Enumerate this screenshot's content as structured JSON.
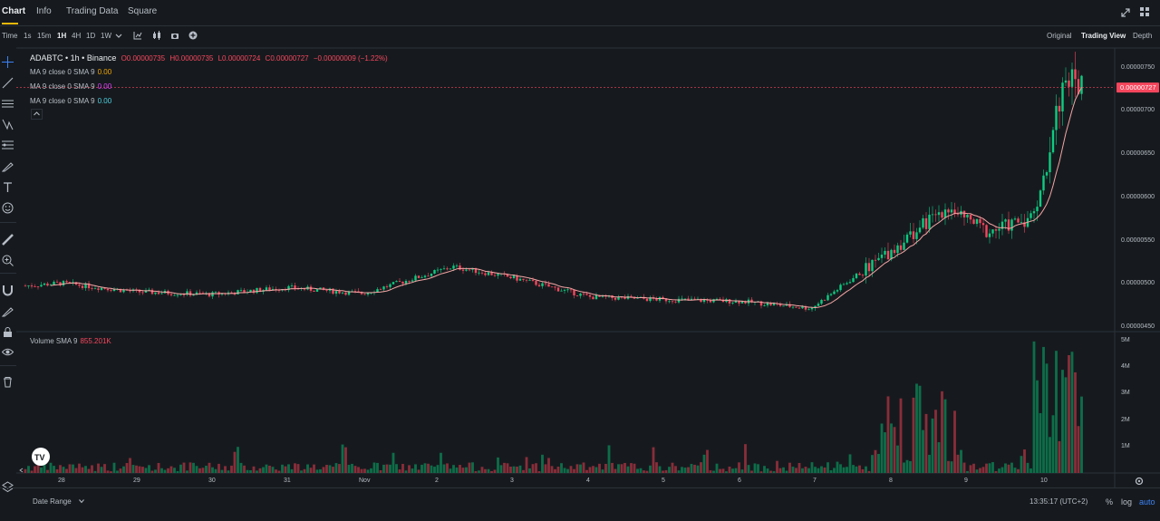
{
  "nav": {
    "tabs": [
      "Chart",
      "Info",
      "Trading Data",
      "Square"
    ]
  },
  "toolbar": {
    "time_label": "Time",
    "intervals": [
      "1s",
      "15m",
      "1H",
      "4H",
      "1D",
      "1W"
    ],
    "active_interval": "1H",
    "views": [
      "Original",
      "Trading View",
      "Depth"
    ],
    "active_view": "Trading View"
  },
  "legend": {
    "title": "ADABTC • 1h • Binance",
    "open": "O0.00000735",
    "high": "H0.00000735",
    "low": "L0.00000724",
    "close": "C0.00000727",
    "change": "−0.00000009 (−1.22%)",
    "ma_lines": [
      {
        "label": "MA 9 close 0 SMA 9",
        "value": "0.00",
        "color": "#f0a500"
      },
      {
        "label": "MA 9 close 0 SMA 9",
        "value": "0.00",
        "color": "#e040fb"
      },
      {
        "label": "MA 9 close 0 SMA 9",
        "value": "0.00",
        "color": "#4dd0e1"
      }
    ]
  },
  "price_axis": {
    "ticks": [
      "0.00000750",
      "0.00000700",
      "0.00000650",
      "0.00000600",
      "0.00000550",
      "0.00000500",
      "0.00000450"
    ],
    "current": "0.00000727"
  },
  "volume": {
    "label": "Volume SMA 9",
    "value": "855.201K",
    "ticks": [
      "5M",
      "4M",
      "3M",
      "2M",
      "1M"
    ]
  },
  "time_axis": {
    "labels": [
      "28",
      "29",
      "30",
      "31",
      "Nov",
      "2",
      "3",
      "4",
      "5",
      "6",
      "7",
      "8",
      "9",
      "10"
    ]
  },
  "bottom": {
    "date_range": "Date Range",
    "clock": "13:35:17 (UTC+2)",
    "pct": "%",
    "log": "log",
    "auto": "auto"
  },
  "colors": {
    "up": "#0ecb81",
    "down": "#f6465d",
    "ma": "#f6a5a5",
    "accent": "#f0b90b",
    "auto": "#3b82f6"
  },
  "chart_data": {
    "type": "line",
    "description_free": true,
    "x": [
      "Oct 28",
      "Oct 29",
      "Oct 30",
      "Oct 31",
      "Nov 1",
      "Nov 2",
      "Nov 3",
      "Nov 4",
      "Nov 5",
      "Nov 6",
      "Nov 7",
      "Nov 8",
      "Nov 8.5",
      "Nov 9",
      "Nov 10",
      "Nov 10.3",
      "Nov 10.5"
    ],
    "series": [
      {
        "values": [
          5e-06,
          4.94e-06,
          4.87e-06,
          4.97e-06,
          4.94e-06,
          5.2e-06,
          5.02e-06,
          4.85e-06,
          4.8e-06,
          4.79e-06,
          4.7e-06,
          5.3e-06,
          5.9e-06,
          5.6e-06,
          5.8e-06,
          7.4e-06,
          7.27e-06
        ]
      }
    ],
    "ylim": [
      4.45e-06,
      7.57e-06
    ],
    "volume_ylim": [
      0,
      5200000
    ]
  }
}
